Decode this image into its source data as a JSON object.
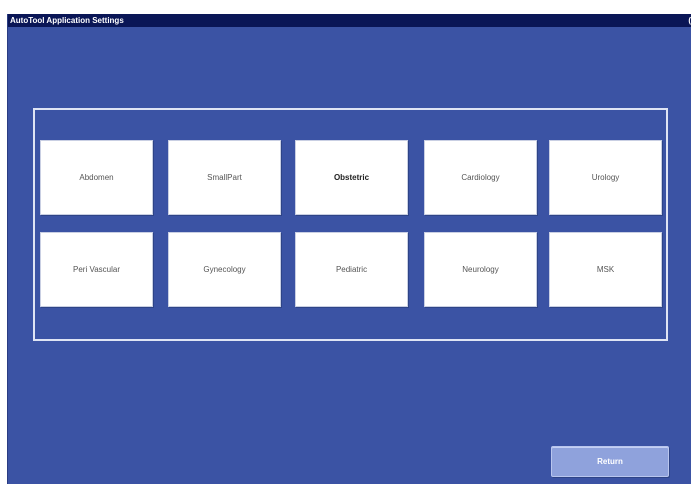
{
  "window": {
    "title": "AutoTool Application Settings",
    "title_right": "("
  },
  "applications": [
    {
      "label": "Abdomen"
    },
    {
      "label": "SmallPart"
    },
    {
      "label": "Obstetric",
      "selected": true
    },
    {
      "label": "Cardiology"
    },
    {
      "label": "Urology"
    },
    {
      "label": "Peri Vascular"
    },
    {
      "label": "Gynecology"
    },
    {
      "label": "Pediatric"
    },
    {
      "label": "Neurology"
    },
    {
      "label": "MSK"
    }
  ],
  "footer": {
    "return_label": "Return"
  }
}
